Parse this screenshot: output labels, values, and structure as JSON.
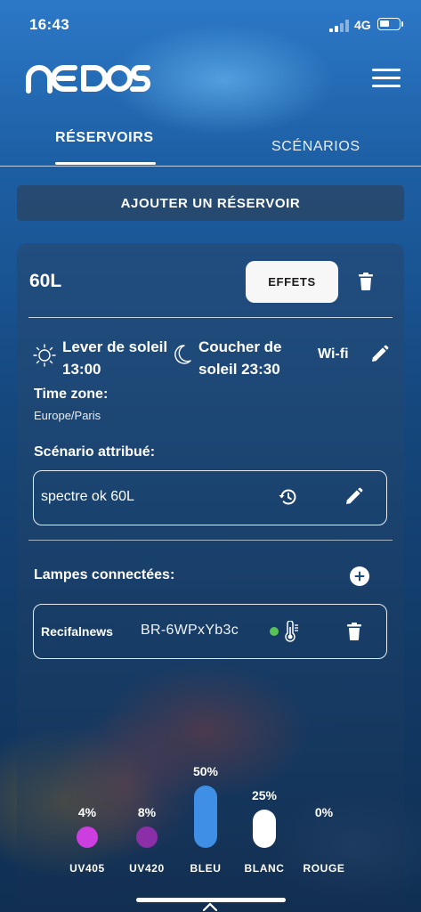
{
  "status_bar": {
    "time": "16:43",
    "network": "4G"
  },
  "header": {
    "logo_text": "NEDOS"
  },
  "tabs": [
    {
      "label": "RÉSERVOIRS",
      "active": true
    },
    {
      "label": "SCÉNARIOS",
      "active": false
    }
  ],
  "add_reservoir_label": "AJOUTER UN RÉSERVOIR",
  "reservoir": {
    "name": "60L",
    "effects_label": "EFFETS",
    "sunrise": "Lever de soleil 13:00",
    "sunset": "Coucher de soleil 23:30",
    "wifi_label": "Wi-fi",
    "timezone_label": "Time zone:",
    "timezone_value": "Europe/Paris",
    "scenario_label": "Scénario attribué:",
    "scenario_value": "spectre ok 60L",
    "lamps_label": "Lampes connectées:",
    "lamps": [
      {
        "brand": "Recifalnews",
        "id": "BR-6WPxYb3c",
        "status_color": "#59c255"
      }
    ]
  },
  "channels": [
    {
      "name": "UV405",
      "percent": "4%",
      "level": 4,
      "color": "#cc3ee0"
    },
    {
      "name": "UV420",
      "percent": "8%",
      "level": 8,
      "color": "#8a2fa8"
    },
    {
      "name": "BLEU",
      "percent": "50%",
      "level": 50,
      "color": "#3f8fe6"
    },
    {
      "name": "BLANC",
      "percent": "25%",
      "level": 25,
      "color": "#ffffff"
    },
    {
      "name": "ROUGE",
      "percent": "0%",
      "level": 0,
      "color": "#d23a2a"
    }
  ]
}
